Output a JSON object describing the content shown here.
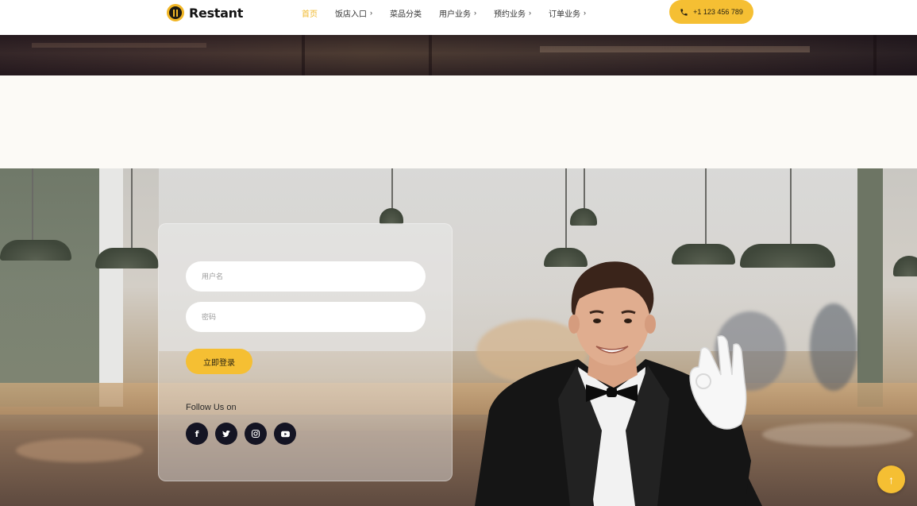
{
  "brand": {
    "name": "Restant",
    "logo_icon": "restaurant-logo-icon"
  },
  "nav": {
    "items": [
      {
        "label": "首页",
        "has_dropdown": false,
        "active": true
      },
      {
        "label": "饭店入口",
        "has_dropdown": true,
        "active": false
      },
      {
        "label": "菜品分类",
        "has_dropdown": false,
        "active": false
      },
      {
        "label": "用户业务",
        "has_dropdown": true,
        "active": false
      },
      {
        "label": "预约业务",
        "has_dropdown": true,
        "active": false
      },
      {
        "label": "订单业务",
        "has_dropdown": true,
        "active": false
      }
    ],
    "chevron": "›"
  },
  "header": {
    "phone": "+1 123 456 789",
    "phone_icon": "phone-icon"
  },
  "login": {
    "username_placeholder": "用户名",
    "password_placeholder": "密码",
    "submit_label": "立即登录",
    "follow_label": "Follow Us on",
    "socials": [
      {
        "name": "facebook-icon",
        "glyph": "f"
      },
      {
        "name": "twitter-icon",
        "glyph": "🐦"
      },
      {
        "name": "instagram-icon",
        "glyph": "◎"
      },
      {
        "name": "youtube-icon",
        "glyph": "▶"
      }
    ]
  },
  "scroll_top": {
    "icon": "arrow-up-icon",
    "glyph": "↑"
  },
  "colors": {
    "accent": "#f5bf33",
    "nav_active": "#f0b82b",
    "social_bg": "#141423",
    "text_dark": "#141414"
  }
}
